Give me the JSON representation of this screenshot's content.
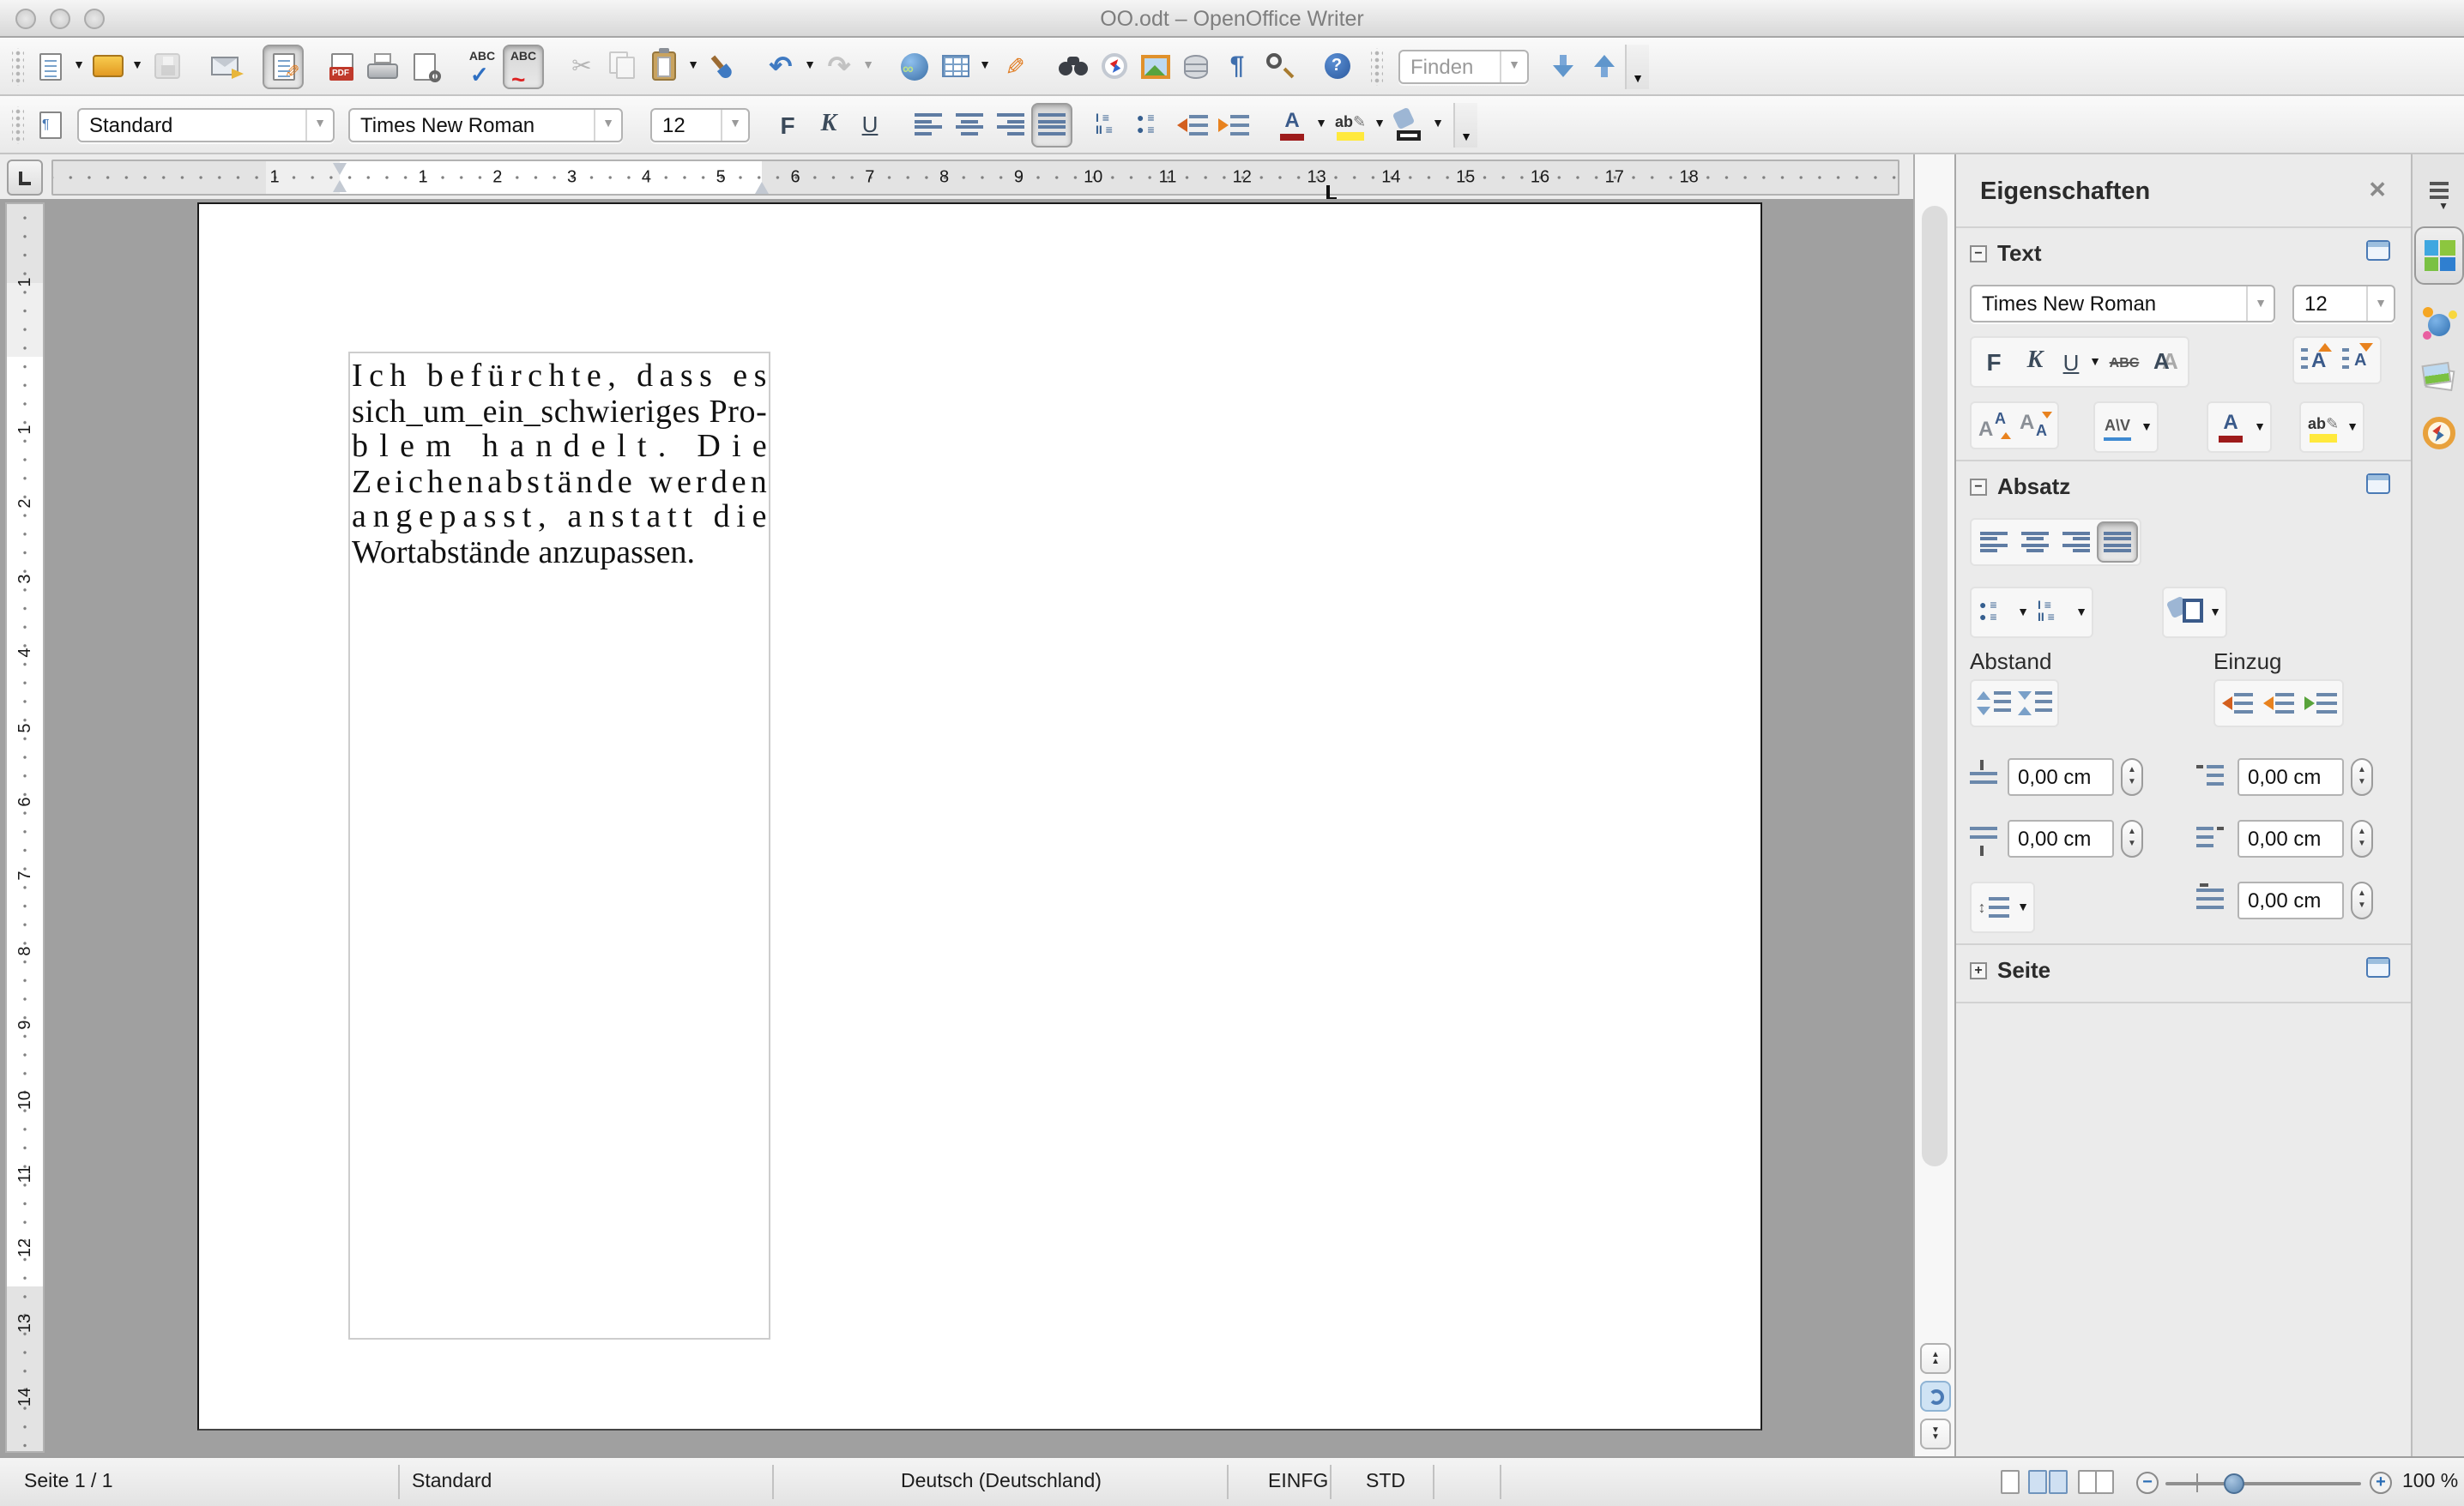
{
  "window": {
    "title": "OO.odt – OpenOffice Writer"
  },
  "toolbars": {
    "find_placeholder": "Finden",
    "style_combo": "Standard",
    "font_combo": "Times New Roman",
    "size_combo": "12",
    "bold_label": "F",
    "italic_label": "K",
    "underline_label": "U",
    "pdf_label": "PDF",
    "abc_label": "ABC"
  },
  "ruler": {
    "h_margin_number": "1",
    "h_numbers": [
      1,
      2,
      3,
      4,
      5,
      6,
      7,
      8,
      9,
      10,
      11,
      12,
      13,
      14,
      15,
      16,
      17,
      18
    ],
    "v_margin_number": "1",
    "v_numbers": [
      1,
      2,
      3,
      4,
      5,
      6,
      7,
      8,
      9,
      10,
      11,
      12,
      13,
      14
    ]
  },
  "document": {
    "lines": [
      "Ich befürchte, dass es",
      "sich_um_ein_schwieriges Pro-",
      "blem handelt. Die",
      "Zeichenabstände werden",
      "angepasst, anstatt die",
      "Wortabstände anzupassen."
    ]
  },
  "sidebar": {
    "title": "Eigenschaften",
    "text_section": {
      "label": "Text",
      "font": "Times New Roman",
      "size": "12",
      "bold": "F",
      "italic": "K",
      "underline": "U",
      "strike": "ABC",
      "shadow": "A"
    },
    "paragraph_section": {
      "label": "Absatz",
      "spacing_label": "Abstand",
      "indent_label": "Einzug",
      "spacing_above": "0,00 cm",
      "spacing_below": "0,00 cm",
      "indent_before": "0,00 cm",
      "indent_after": "0,00 cm",
      "indent_firstline": "0,00 cm"
    },
    "page_section": {
      "label": "Seite"
    }
  },
  "statusbar": {
    "page": "Seite 1 / 1",
    "style": "Standard",
    "language": "Deutsch (Deutschland)",
    "insert_mode": "EINFG",
    "selection_mode": "STD",
    "zoom_level": "100 %"
  },
  "colors": {
    "accent_blue": "#4a7ab5",
    "font_color_red": "#9e1b1b",
    "highlight_yellow": "#ffe93c",
    "title_gray": "#7e7e7e",
    "doc_background": "#a0a0a0"
  }
}
